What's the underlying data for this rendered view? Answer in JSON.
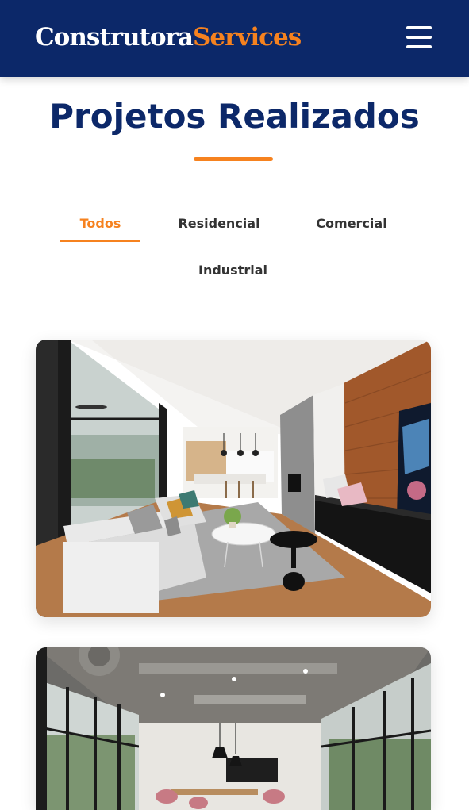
{
  "navbar": {
    "brand_part1": "Construtora",
    "brand_part2": "Services",
    "menu_icon": "hamburger-menu-icon"
  },
  "projects": {
    "title": "Projetos Realizados",
    "filters": [
      {
        "label": "Todos",
        "active": true
      },
      {
        "label": "Residencial",
        "active": false
      },
      {
        "label": "Comercial",
        "active": false
      },
      {
        "label": "Industrial",
        "active": false
      }
    ],
    "cards": [
      {
        "image": "modern-living-room-photo"
      },
      {
        "image": "industrial-office-dining-photo"
      }
    ]
  },
  "colors": {
    "navy": "#0c2869",
    "accent": "#f6821f",
    "text": "#333333"
  }
}
